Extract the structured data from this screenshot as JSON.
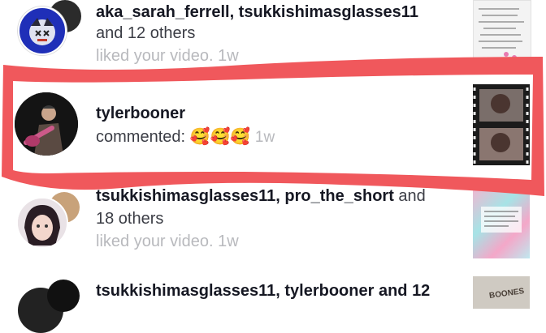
{
  "notifications": [
    {
      "users_line": "aka_sarah_ferrell, tsukkishimasglasses11",
      "others_line": "and 12 others",
      "action": "liked your video.",
      "time": "1w"
    },
    {
      "username": "tylerbooner",
      "action": "commented:",
      "comment_emoji": "🥰🥰🥰",
      "time": "1w"
    },
    {
      "user1": "tsukkishimasglasses11",
      "user2": "pro_the_short",
      "and_word": "and",
      "others_line": "18 others",
      "action": "liked your video.",
      "time": "1w"
    },
    {
      "users_line": "tsukkishimasglasses11, tylerbooner and 12"
    }
  ],
  "thumbnail_text": {
    "bottom": "BOONES"
  },
  "colors": {
    "highlight": "#f0585c",
    "text": "#161823",
    "muted": "#b8b9bd"
  }
}
